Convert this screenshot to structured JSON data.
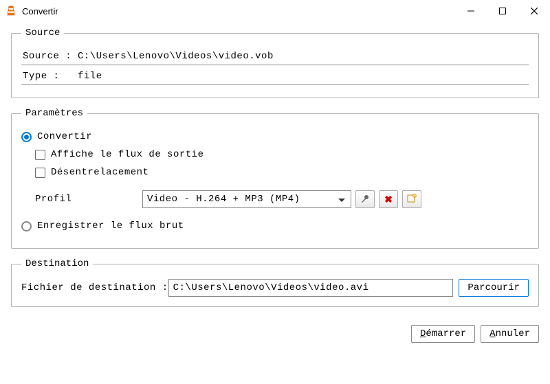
{
  "window": {
    "title": "Convertir"
  },
  "source": {
    "legend": "Source",
    "source_label": "Source :",
    "source_value": "C:\\Users\\Lenovo\\Videos\\video.vob",
    "type_label": "Type :",
    "type_value": "file"
  },
  "params": {
    "legend": "Paramètres",
    "convert_label": "Convertir",
    "convert_checked": true,
    "show_output_label": "Affiche le flux de sortie",
    "deinterlace_label": "Désentrelacement",
    "profile_label": "Profil",
    "profile_value": "Video - H.264 + MP3 (MP4)",
    "raw_label": "Enregistrer le flux brut"
  },
  "dest": {
    "legend": "Destination",
    "file_label": "Fichier de destination :",
    "file_value": "C:\\Users\\Lenovo\\Videos\\video.avi",
    "browse_label": "Parcourir"
  },
  "buttons": {
    "start": "Démarrer",
    "cancel": "Annuler"
  }
}
